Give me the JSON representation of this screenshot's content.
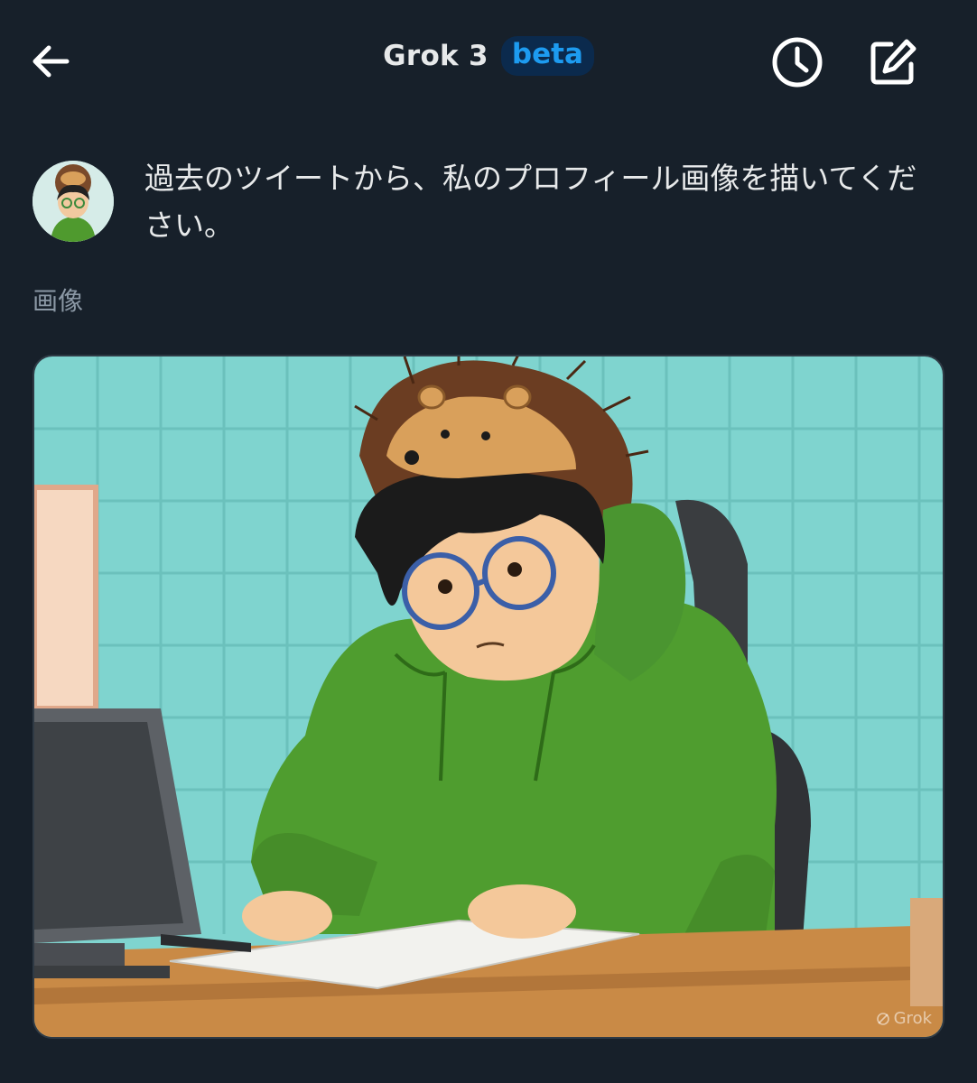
{
  "header": {
    "title": "Grok 3",
    "badge": "beta",
    "back_icon": "arrow-left-icon",
    "history_icon": "clock-icon",
    "compose_icon": "edit-icon"
  },
  "message": {
    "prompt": "過去のツイートから、私のプロフィール画像を描いてください。"
  },
  "response": {
    "label": "画像",
    "watermark": "Grok"
  },
  "colors": {
    "background": "#17202a",
    "accent": "#1d9bf0",
    "badge_bg": "#0b2a4d",
    "text": "#e7e9ea",
    "muted": "#8b98a5"
  }
}
